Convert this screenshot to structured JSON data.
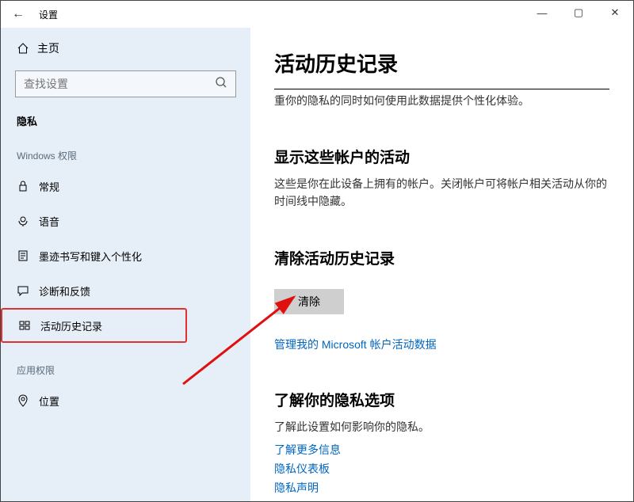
{
  "titlebar": {
    "back": "←",
    "title": "设置"
  },
  "window": {
    "min": "—",
    "max": "▢",
    "close": "✕"
  },
  "sidebar": {
    "home": "主页",
    "search_placeholder": "查找设置",
    "privacy_label": "隐私",
    "win_perm_label": "Windows 权限",
    "items": [
      {
        "label": "常规"
      },
      {
        "label": "语音"
      },
      {
        "label": "墨迹书写和键入个性化"
      },
      {
        "label": "诊断和反馈"
      },
      {
        "label": "活动历史记录"
      }
    ],
    "app_perm_label": "应用权限",
    "location": "位置"
  },
  "content": {
    "h1": "活动历史记录",
    "clipped": "重你的隐私的同时如何使用此数据提供个性化体验。",
    "accounts_h2": "显示这些帐户的活动",
    "accounts_p": "这些是你在此设备上拥有的帐户。关闭帐户可将帐户相关活动从你的时间线中隐藏。",
    "clear_h2": "清除活动历史记录",
    "clear_btn": "清除",
    "manage_link": "管理我的 Microsoft 帐户活动数据",
    "learn_h2": "了解你的隐私选项",
    "learn_sub": "了解此设置如何影响你的隐私。",
    "link1": "了解更多信息",
    "link2": "隐私仪表板",
    "link3": "隐私声明"
  }
}
